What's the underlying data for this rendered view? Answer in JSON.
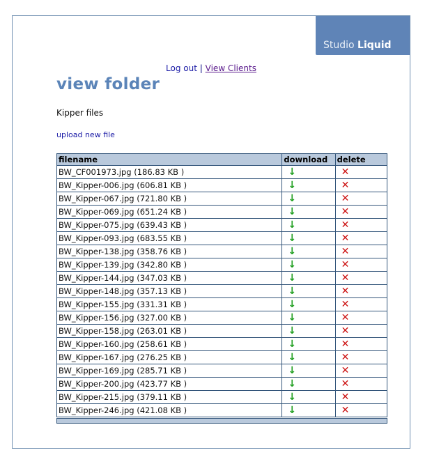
{
  "brand": {
    "prefix": "Studio",
    "name": "Liquid"
  },
  "nav": {
    "logout": "Log out",
    "separator": "|",
    "clients": "View Clients"
  },
  "page": {
    "title": "view folder",
    "folder_name": "Kipper files",
    "upload_link": "upload new file"
  },
  "table": {
    "headers": {
      "filename": "filename",
      "download": "download",
      "delete": "delete"
    },
    "download_icon": "↓",
    "delete_icon": "✕",
    "rows": [
      {
        "file": "BW_CF001973.jpg (186.83 KB )"
      },
      {
        "file": "BW_Kipper-006.jpg (606.81 KB )"
      },
      {
        "file": "BW_Kipper-067.jpg (721.80 KB )"
      },
      {
        "file": "BW_Kipper-069.jpg (651.24 KB )"
      },
      {
        "file": "BW_Kipper-075.jpg (639.43 KB )"
      },
      {
        "file": "BW_Kipper-093.jpg (683.55 KB )"
      },
      {
        "file": "BW_Kipper-138.jpg (358.76 KB )"
      },
      {
        "file": "BW_Kipper-139.jpg (342.80 KB )"
      },
      {
        "file": "BW_Kipper-144.jpg (347.03 KB )"
      },
      {
        "file": "BW_Kipper-148.jpg (357.13 KB )"
      },
      {
        "file": "BW_Kipper-155.jpg (331.31 KB )"
      },
      {
        "file": "BW_Kipper-156.jpg (327.00 KB )"
      },
      {
        "file": "BW_Kipper-158.jpg (263.01 KB )"
      },
      {
        "file": "BW_Kipper-160.jpg (258.61 KB )"
      },
      {
        "file": "BW_Kipper-167.jpg (276.25 KB )"
      },
      {
        "file": "BW_Kipper-169.jpg (285.71 KB )"
      },
      {
        "file": "BW_Kipper-200.jpg (423.77 KB )"
      },
      {
        "file": "BW_Kipper-215.jpg (379.11 KB )"
      },
      {
        "file": "BW_Kipper-246.jpg (421.08 KB )"
      }
    ]
  },
  "colors": {
    "brand_bg": "#5f84b7",
    "title": "#5b84b8",
    "header_bg": "#b9c9dc",
    "download": "#22a022",
    "delete": "#cc1111"
  }
}
